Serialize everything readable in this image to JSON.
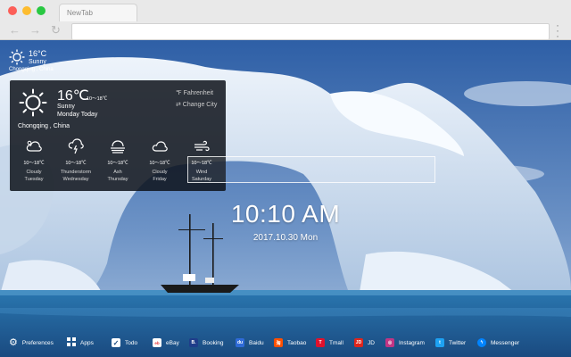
{
  "browser": {
    "tab_title": "NewTab",
    "back_icon": "back-arrow-icon",
    "forward_icon": "forward-arrow-icon",
    "reload_icon": "reload-icon",
    "menu_icon": "menu-dots-icon",
    "address_value": ""
  },
  "weather_mini": {
    "temp": "16°C",
    "condition": "Sunny",
    "location": "Chongqing , China",
    "icon": "sun-icon"
  },
  "weather_panel": {
    "temp": "16℃",
    "range": "10～18℃",
    "condition": "Sunny",
    "day": "Monday Today",
    "unit_toggle": "℉  Fahrenheit",
    "change_city": "⇄  Change City",
    "location": "Chongqing , China",
    "forecast": [
      {
        "icon": "cloudy-icon",
        "range": "10～18℃",
        "condition": "Cloudy",
        "day": "Tuesday"
      },
      {
        "icon": "thunderstorm-icon",
        "range": "10～18℃",
        "condition": "Thunderstorm",
        "day": "Wednesday"
      },
      {
        "icon": "ash-icon",
        "range": "10～18℃",
        "condition": "Ash",
        "day": "Thursday"
      },
      {
        "icon": "cloudy-icon",
        "range": "10～18℃",
        "condition": "Cloudy",
        "day": "Friday"
      },
      {
        "icon": "wind-icon",
        "range": "10～18℃",
        "condition": "Wind",
        "day": "Saturday"
      }
    ]
  },
  "search": {
    "value": ""
  },
  "clock": {
    "time": "10:10 AM",
    "date": "2017.10.30 Mon"
  },
  "bottom_bar": {
    "items": [
      {
        "label": "Preferences",
        "icon": "gear-icon",
        "color": "transparent"
      },
      {
        "label": "Apps",
        "icon": "grid-icon",
        "color": "transparent"
      },
      {
        "label": "Todo",
        "icon": "checkbox-icon",
        "color": "#ffffff"
      },
      {
        "label": "eBay",
        "icon": "ebay-icon",
        "color": "#ffffff"
      },
      {
        "label": "Booking",
        "icon": "booking-icon",
        "color": "#1f3d8a"
      },
      {
        "label": "Baidu",
        "icon": "baidu-icon",
        "color": "#2f6bd8"
      },
      {
        "label": "Taobao",
        "icon": "taobao-icon",
        "color": "#ff5000"
      },
      {
        "label": "Tmall",
        "icon": "tmall-icon",
        "color": "#e0112c"
      },
      {
        "label": "JD",
        "icon": "jd-icon",
        "color": "#e1251b"
      },
      {
        "label": "Instagram",
        "icon": "instagram-icon",
        "color": "#c13584"
      },
      {
        "label": "Twitter",
        "icon": "twitter-icon",
        "color": "#1da1f2"
      },
      {
        "label": "Messenger",
        "icon": "messenger-icon",
        "color": "#0084ff"
      }
    ]
  }
}
